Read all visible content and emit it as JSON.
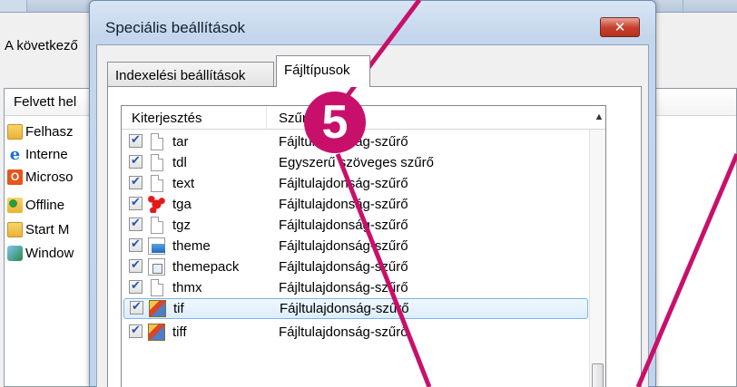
{
  "background_window": {
    "intro_text": "A következő",
    "list_header": "Felvett hel",
    "items": [
      {
        "label": "Felhasz",
        "icon": "folder-icon"
      },
      {
        "label": "Interne",
        "icon": "internet-explorer-icon"
      },
      {
        "label": "Microso",
        "icon": "office-icon"
      },
      {
        "label": "Offline",
        "icon": "offline-files-icon"
      },
      {
        "label": "Start M",
        "icon": "folder-icon"
      },
      {
        "label": "Window",
        "icon": "windows-icon"
      }
    ]
  },
  "dialog": {
    "title": "Speciális beállítások",
    "close_label": "✕",
    "tabs": [
      {
        "label": "Indexelési beállítások",
        "active": false
      },
      {
        "label": "Fájltípusok",
        "active": true
      }
    ],
    "grid": {
      "col_ext": "Kiterjesztés",
      "col_desc": "Szűrő leírása",
      "rows": [
        {
          "ext": "tar",
          "desc": "Fájltulajdonság-szűrő",
          "checked": true,
          "icon": "generic-file-icon",
          "selected": false
        },
        {
          "ext": "tdl",
          "desc": "Egyszerű szöveges szűrő",
          "checked": true,
          "icon": "generic-file-icon",
          "selected": false
        },
        {
          "ext": "text",
          "desc": "Fájltulajdonság-szűrő",
          "checked": true,
          "icon": "generic-file-icon",
          "selected": false
        },
        {
          "ext": "tga",
          "desc": "Fájltulajdonság-szűrő",
          "checked": true,
          "icon": "paint-splash-icon",
          "selected": false
        },
        {
          "ext": "tgz",
          "desc": "Fájltulajdonság-szűrő",
          "checked": true,
          "icon": "generic-file-icon",
          "selected": false
        },
        {
          "ext": "theme",
          "desc": "Fájltulajdonság-szűrő",
          "checked": true,
          "icon": "theme-file-icon",
          "selected": false
        },
        {
          "ext": "themepack",
          "desc": "Fájltulajdonság-szűrő",
          "checked": true,
          "icon": "themepack-file-icon",
          "selected": false
        },
        {
          "ext": "thmx",
          "desc": "Fájltulajdonság-szűrő",
          "checked": true,
          "icon": "generic-file-icon",
          "selected": false
        },
        {
          "ext": "tif",
          "desc": "Fájltulajdonság-szűrő",
          "checked": true,
          "icon": "image-file-icon",
          "selected": true
        },
        {
          "ext": "tiff",
          "desc": "Fájltulajdonság-szűrő",
          "checked": true,
          "icon": "image-file-icon",
          "selected": false
        }
      ]
    }
  },
  "callout": {
    "number": "5",
    "color": "#c8106b"
  }
}
